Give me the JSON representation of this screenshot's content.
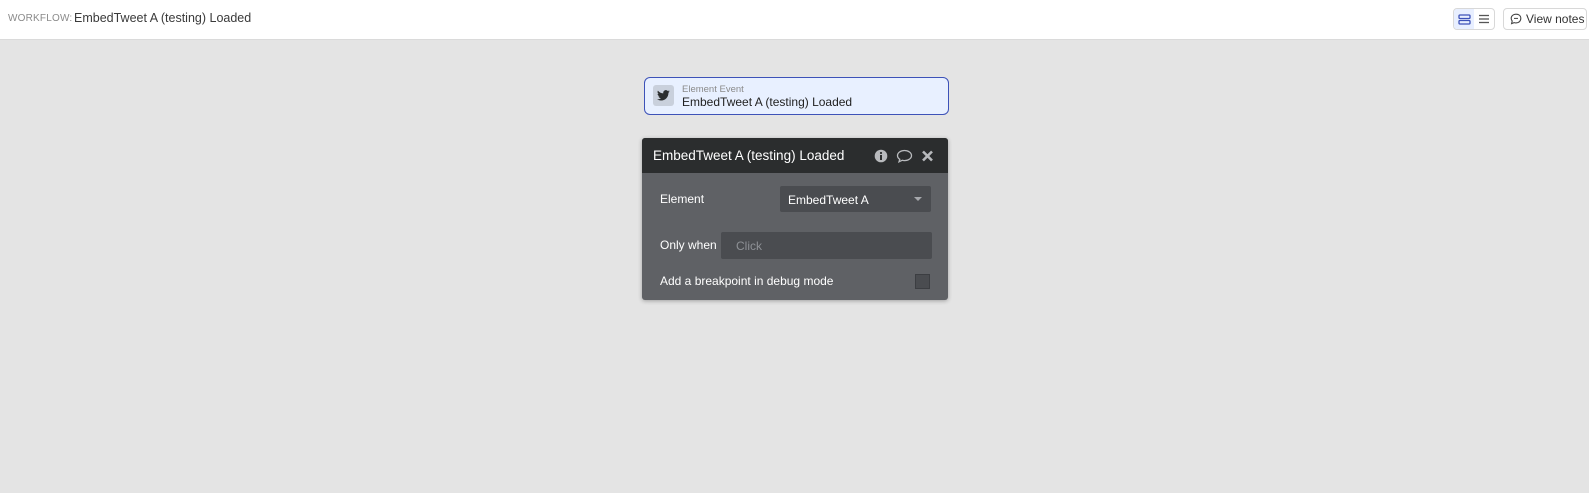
{
  "topbar": {
    "workflow_label": "WORKFLOW:",
    "workflow_name": "EmbedTweet A (testing) Loaded",
    "view_toggle": {
      "icons": [
        "stacked-view-icon",
        "list-view-icon"
      ],
      "active": "stacked-view-icon"
    },
    "notes_button": {
      "label": "View notes",
      "icon": "chat-bubble-icon"
    }
  },
  "event_card": {
    "icon": "twitter-bird-icon",
    "type": "Element Event",
    "title": "EmbedTweet A (testing) Loaded"
  },
  "panel": {
    "title": "EmbedTweet A (testing) Loaded",
    "header_icons": [
      "info-icon",
      "comment-icon",
      "close-icon"
    ],
    "element_row": {
      "label": "Element",
      "value": "EmbedTweet A"
    },
    "only_when_row": {
      "label": "Only when",
      "placeholder": "Click"
    },
    "breakpoint_row": {
      "label": "Add a breakpoint in debug mode",
      "checked": false
    }
  },
  "colors": {
    "canvas": "#e4e4e4",
    "accent": "#3d52b8",
    "event_card_bg": "#e8f0ff",
    "panel_header": "#2b2d2e",
    "panel_body": "#5f6165"
  }
}
